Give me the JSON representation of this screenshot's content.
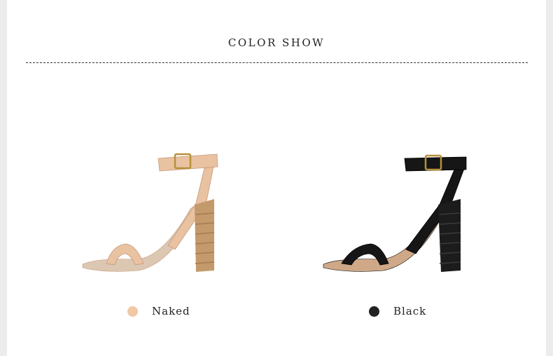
{
  "section": {
    "title": "COLOR SHOW"
  },
  "variants": [
    {
      "label": "Naked",
      "color": "#f0c8a4",
      "strap": "#e9c2a2",
      "strap_edge": "#c79a78",
      "heel": "#c49a6c",
      "heel_line": "#a57b52",
      "sole": "#dcc7b3"
    },
    {
      "label": "Black",
      "color": "#222222",
      "strap": "#161616",
      "strap_edge": "#000000",
      "heel": "#1c1c1c",
      "heel_line": "#3a3a3a",
      "sole": "#cfa887"
    }
  ]
}
